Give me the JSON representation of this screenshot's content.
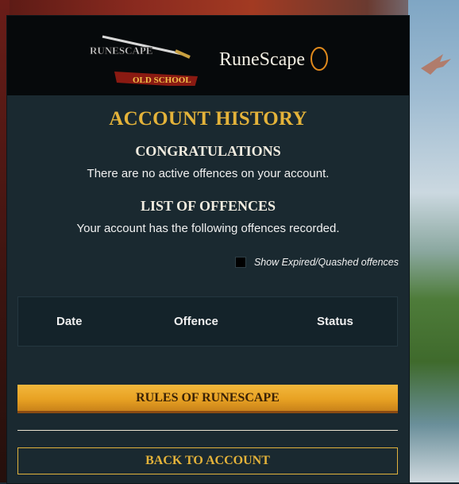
{
  "logos": {
    "osrs_text": "RUNESCAPE",
    "osrs_banner": "OLD SCHOOL",
    "rs_text": "RuneScape"
  },
  "title": "ACCOUNT HISTORY",
  "congrats": {
    "heading": "CONGRATULATIONS",
    "text": "There are no active offences on your account."
  },
  "offences": {
    "heading": "LIST OF OFFENCES",
    "text": "Your account has the following offences recorded.",
    "show_expired_label": "Show Expired/Quashed offences",
    "show_expired_checked": false
  },
  "table": {
    "columns": [
      "Date",
      "Offence",
      "Status"
    ]
  },
  "buttons": {
    "rules_label": "RULES OF RUNESCAPE",
    "back_label": "BACK TO ACCOUNT"
  },
  "colors": {
    "accent_gold": "#e4b33a",
    "panel_bg": "#1a2930",
    "button_gold": "#e8a223"
  }
}
